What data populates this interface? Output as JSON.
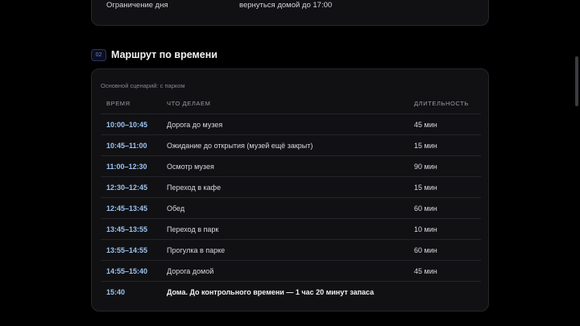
{
  "top_card": {
    "label": "Ограничение дня",
    "value": "вернуться домой до 17:00"
  },
  "section": {
    "number": "02",
    "title": "Маршрут по времени"
  },
  "table": {
    "subtitle": "Основной сценарий: с парком",
    "headers": {
      "time": "ВРЕМЯ",
      "activity": "ЧТО ДЕЛАЕМ",
      "duration": "ДЛИТЕЛЬНОСТЬ"
    },
    "rows": [
      {
        "time": "10:00–10:45",
        "activity": "Дорога до музея",
        "duration": "45 мин"
      },
      {
        "time": "10:45–11:00",
        "activity": "Ожидание до открытия (музей ещё закрыт)",
        "duration": "15 мин"
      },
      {
        "time": "11:00–12:30",
        "activity": "Осмотр музея",
        "duration": "90 мин"
      },
      {
        "time": "12:30–12:45",
        "activity": "Переход в кафе",
        "duration": "15 мин"
      },
      {
        "time": "12:45–13:45",
        "activity": "Обед",
        "duration": "60 мин"
      },
      {
        "time": "13:45–13:55",
        "activity": "Переход в парк",
        "duration": "10 мин"
      },
      {
        "time": "13:55–14:55",
        "activity": "Прогулка в парке",
        "duration": "60 мин"
      },
      {
        "time": "14:55–15:40",
        "activity": "Дорога домой",
        "duration": "45 мин"
      }
    ],
    "final": {
      "time": "15:40",
      "activity": "Дома. До контрольного времени — 1 час 20 минут запаса"
    }
  },
  "colors": {
    "background": "#000000",
    "card": "#111114",
    "time_accent": "#9cc4ef",
    "section_badge": "#6c7fd8"
  }
}
